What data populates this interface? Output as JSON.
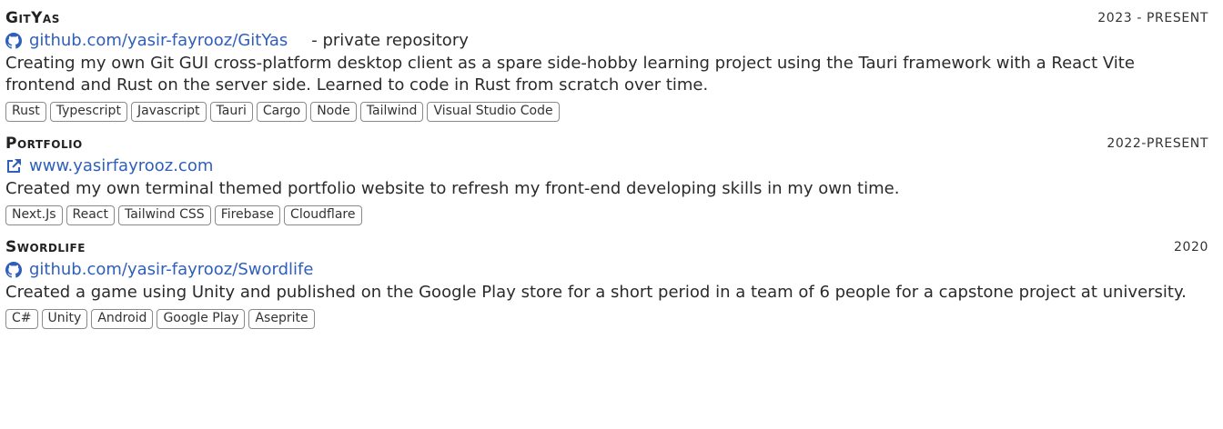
{
  "projects": [
    {
      "title": "GitYas",
      "date": "2023 - PRESENT",
      "icon": "github-icon",
      "link": "github.com/yasir-fayrooz/GitYas",
      "note": "- private repository",
      "description": "Creating my own Git GUI cross-platform desktop client as a spare side-hobby learning project using the Tauri framework with a React Vite frontend and Rust on the server side. Learned to code in Rust from scratch over time.",
      "tags": [
        "Rust",
        "Typescript",
        "Javascript",
        "Tauri",
        "Cargo",
        "Node",
        "Tailwind",
        "Visual Studio Code"
      ]
    },
    {
      "title": "Portfolio",
      "date": "2022-PRESENT",
      "icon": "external-link-icon",
      "link": "www.yasirfayrooz.com",
      "note": "",
      "description": "Created my own terminal themed portfolio website to refresh my front-end developing skills in my own time.",
      "tags": [
        "Next.Js",
        "React",
        "Tailwind CSS",
        "Firebase",
        "Cloudflare"
      ]
    },
    {
      "title": "Swordlife",
      "date": "2020",
      "icon": "github-icon",
      "link": "github.com/yasir-fayrooz/Swordlife",
      "note": "",
      "description": "Created a game using Unity and published on the Google Play store for a short period in a team of 6 people for a capstone project at university.",
      "tags": [
        "C#",
        "Unity",
        "Android",
        "Google Play",
        "Aseprite"
      ]
    }
  ],
  "colors": {
    "link": "#2f5fb8",
    "text": "#2b2b2b",
    "tag_border": "#8a8a8a"
  }
}
